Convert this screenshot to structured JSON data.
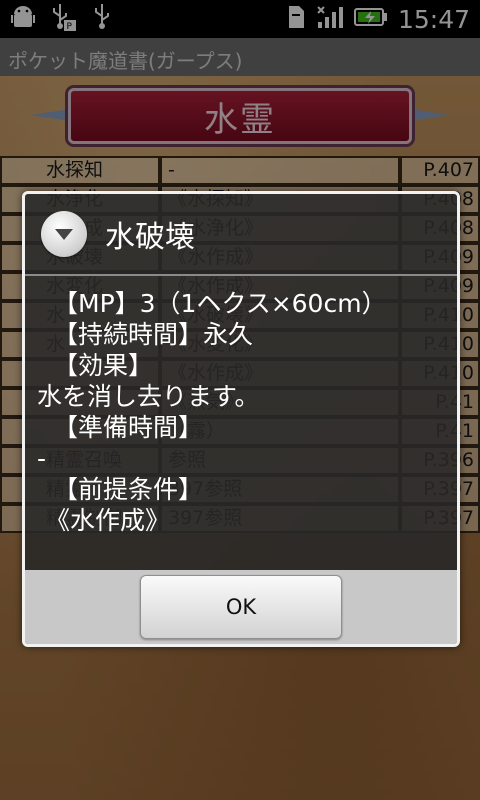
{
  "status_bar": {
    "time": "15:47",
    "icons_left": [
      "android-debug-icon",
      "usb-icon",
      "usb-icon"
    ],
    "icons_right": [
      "sd-card-icon",
      "signal-icon",
      "battery-charging-icon"
    ]
  },
  "app": {
    "title": "ポケット魔道書(ガープス)",
    "category_banner": "水霊",
    "spell_rows": [
      {
        "name": "水探知",
        "prereq": "-",
        "page": "P.407"
      },
      {
        "name": "水浄化",
        "prereq": "《水探知》",
        "page": "P.408"
      },
      {
        "name": "水作成",
        "prereq": "《水浄化》",
        "page": "P.408"
      },
      {
        "name": "水破壊",
        "prereq": "《水作成》",
        "page": "P.409"
      },
      {
        "name": "水変化",
        "prereq": "《水作成》",
        "page": "P.409"
      },
      {
        "name": "水",
        "prereq": "《水破壊》",
        "page": "P.410"
      },
      {
        "name": "水",
        "prereq": "《水変化》",
        "page": "P.410"
      },
      {
        "name": "",
        "prereq": "《水作成》",
        "page": "P.410"
      },
      {
        "name": "",
        "prereq": "《蒸気》",
        "page": "P.41"
      },
      {
        "name": "",
        "prereq": "（霧）",
        "page": "P.41"
      },
      {
        "name": "精霊召喚",
        "prereq": "参照",
        "page": "P.396"
      },
      {
        "name": "精霊",
        "prereq": "397参照",
        "page": "P.397"
      },
      {
        "name": "精霊制御",
        "prereq": "397参照",
        "page": "P.397"
      }
    ]
  },
  "dialog": {
    "title": "水破壊",
    "lines": [
      "【MP】3（1ヘクス×60cm）",
      "【持続時間】永久",
      "【効果】",
      "水を消し去ります。",
      "【準備時間】",
      "-",
      "【前提条件】",
      "《水作成》"
    ],
    "ok_label": "OK"
  }
}
